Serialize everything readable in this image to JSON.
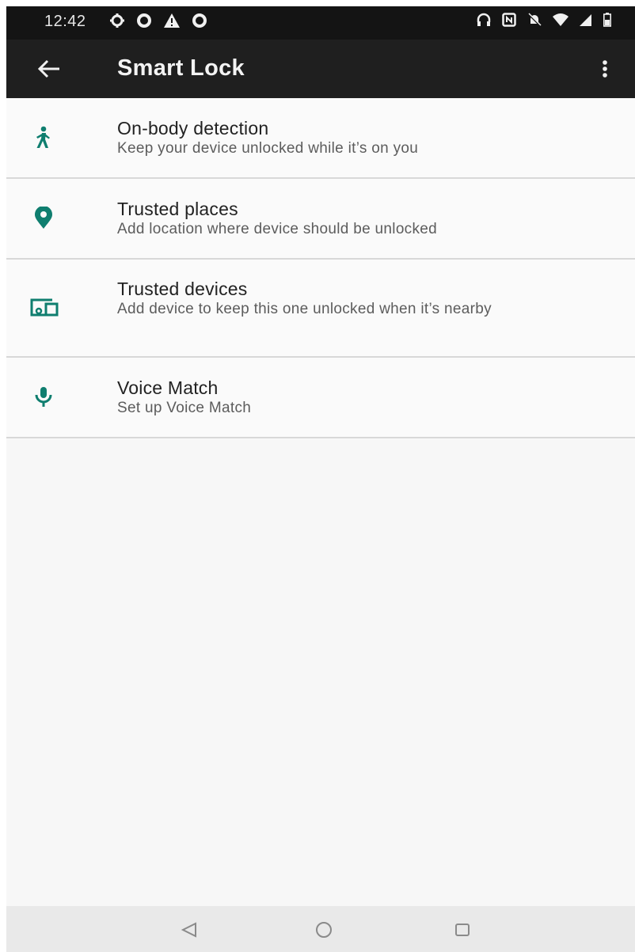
{
  "status_bar": {
    "time": "12:42",
    "left_icons": [
      "gear-icon",
      "ring-icon",
      "alert-icon",
      "ring-icon"
    ],
    "right_icons": [
      "headphones-icon",
      "nfc-icon",
      "mute-icon",
      "wifi-icon",
      "signal-icon",
      "battery-icon"
    ]
  },
  "app_bar": {
    "title": "Smart Lock",
    "back_icon": "arrow-back-icon",
    "overflow_icon": "more-vert-icon"
  },
  "list": {
    "items": [
      {
        "title": "On-body detection",
        "subtitle": "Keep your device unlocked while it’s on you",
        "icon": "walking-person-icon"
      },
      {
        "title": "Trusted places",
        "subtitle": "Add location where device should be unlocked",
        "icon": "location-pin-icon"
      },
      {
        "title": "Trusted devices",
        "subtitle": "Add device to keep this one unlocked when it’s nearby",
        "icon": "devices-icon"
      },
      {
        "title": "Voice Match",
        "subtitle": "Set up Voice Match",
        "icon": "microphone-icon"
      }
    ]
  },
  "nav_bar": {
    "buttons": [
      "back-triangle-icon",
      "home-circle-icon",
      "recents-square-icon"
    ]
  },
  "colors": {
    "accent": "#0f7e6f",
    "app_bar": "#1f1f1f",
    "status_bar": "#141414",
    "background": "#f7f7f7"
  }
}
